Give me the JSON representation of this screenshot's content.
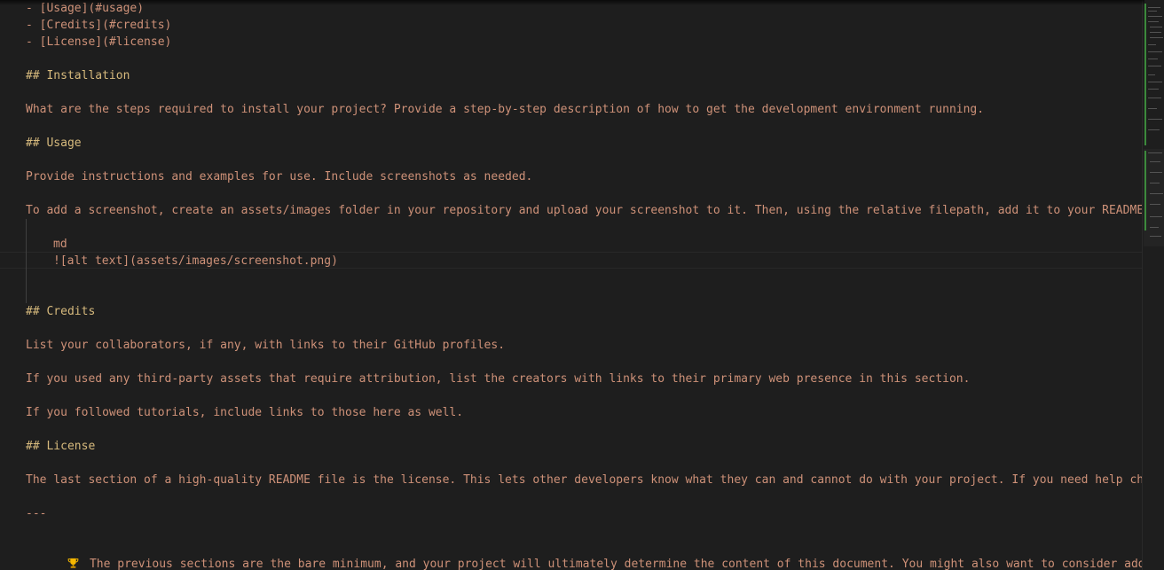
{
  "editor": {
    "lines": [
      {
        "kind": "text",
        "text": "- [Usage](#usage)"
      },
      {
        "kind": "text",
        "text": "- [Credits](#credits)"
      },
      {
        "kind": "text",
        "text": "- [License](#license)"
      },
      {
        "kind": "heading",
        "text": "## Installation"
      },
      {
        "kind": "text",
        "text": "What are the steps required to install your project? Provide a step-by-step description of how to get the development environment running."
      },
      {
        "kind": "heading",
        "text": "## Usage"
      },
      {
        "kind": "text",
        "text": "Provide instructions and examples for use. Include screenshots as needed."
      },
      {
        "kind": "text",
        "text": "To add a screenshot, create an assets/images folder in your repository and upload your screenshot to it. Then, using the relative filepath, add it to your README us"
      },
      {
        "kind": "code",
        "text": "md"
      },
      {
        "kind": "code",
        "text": "![alt text](assets/images/screenshot.png)"
      },
      {
        "kind": "heading",
        "text": "## Credits"
      },
      {
        "kind": "text",
        "text": "List your collaborators, if any, with links to their GitHub profiles."
      },
      {
        "kind": "text",
        "text": "If you used any third-party assets that require attribution, list the creators with links to their primary web presence in this section."
      },
      {
        "kind": "text",
        "text": "If you followed tutorials, include links to those here as well."
      },
      {
        "kind": "heading",
        "text": "## License"
      },
      {
        "kind": "text",
        "text": "The last section of a high-quality README file is the license. This lets other developers know what they can and cannot do with your project. If you need help choos"
      },
      {
        "kind": "text",
        "text": "---"
      },
      {
        "kind": "text",
        "text": "The previous sections are the bare minimum, and your project will ultimately determine the content of this document. You might also want to consider adding the"
      }
    ],
    "trophy_icon": "trophy-icon",
    "colors": {
      "background": "#1e1e1e",
      "text": "#ce9178",
      "heading": "#d7ba7d",
      "minimap_accent": "#3c8a3c"
    }
  }
}
